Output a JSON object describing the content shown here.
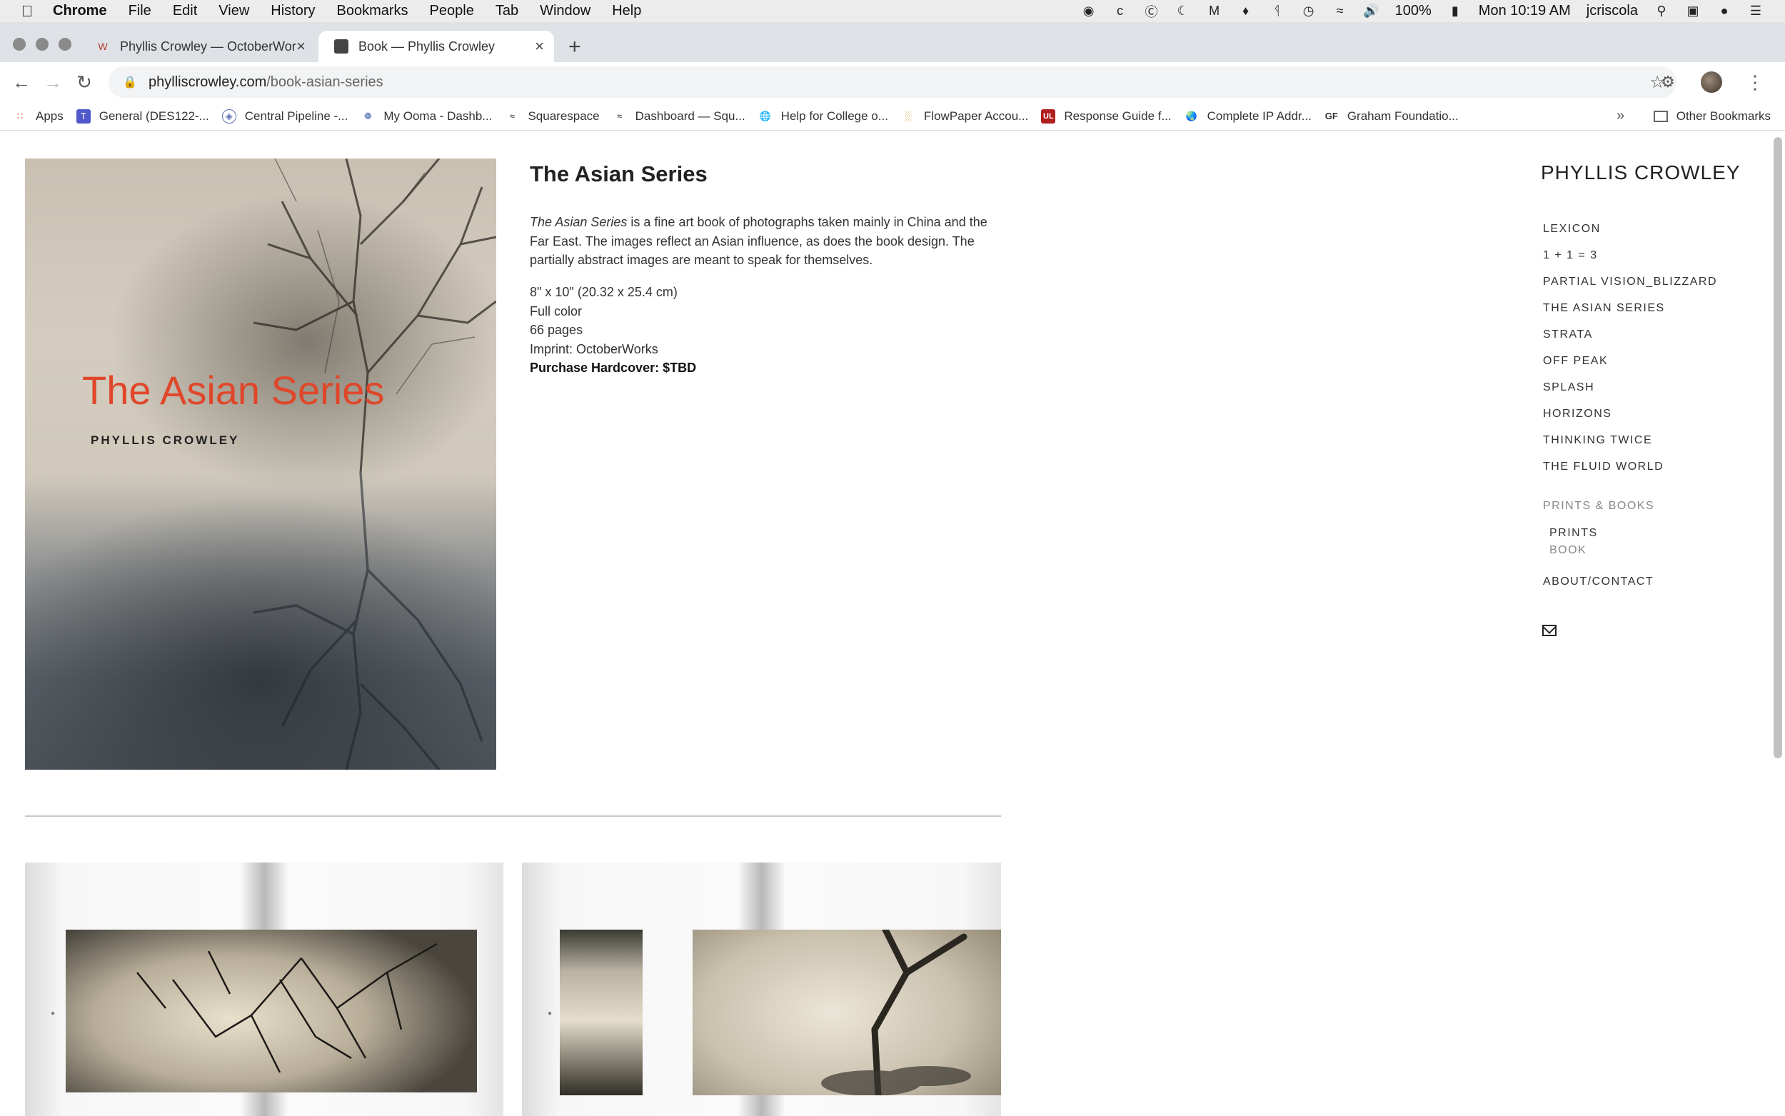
{
  "menubar": {
    "app_name": "Chrome",
    "items": [
      "File",
      "Edit",
      "View",
      "History",
      "Bookmarks",
      "People",
      "Tab",
      "Window",
      "Help"
    ],
    "battery": "100%",
    "clock": "Mon 10:19 AM",
    "user": "jcriscola"
  },
  "tabs": [
    {
      "title": "Phyllis Crowley — OctoberWor",
      "active": false
    },
    {
      "title": "Book — Phyllis Crowley",
      "active": true
    }
  ],
  "address": {
    "host": "phylliscrowley.com",
    "path": "/book-asian-series"
  },
  "bookmarks": {
    "items": [
      "Apps",
      "General (DES122-...",
      "Central Pipeline -...",
      "My Ooma - Dashb...",
      "Squarespace",
      "Dashboard — Squ...",
      "Help for College o...",
      "FlowPaper Accou...",
      "Response Guide f...",
      "Complete IP Addr...",
      "Graham Foundatio..."
    ],
    "more": "»",
    "other": "Other Bookmarks"
  },
  "book": {
    "cover_title": "The Asian Series",
    "cover_author": "PHYLLIS CROWLEY",
    "title": "The Asian Series",
    "description_em": "The Asian Series",
    "description_rest": " is a fine art book of photographs taken mainly in China and the Far East. The images reflect an Asian influence, as does the book design. The partially abstract images are meant to speak for themselves.",
    "size": "8\" x 10\" (20.32 x 25.4 cm)",
    "color": "Full color",
    "pages": "66 pages",
    "imprint": "Imprint: OctoberWorks",
    "purchase": "Purchase Hardcover: $TBD"
  },
  "site": {
    "name": "PHYLLIS CROWLEY",
    "nav": [
      "LEXICON",
      "1 + 1 = 3",
      "PARTIAL VISION_BLIZZARD",
      "THE ASIAN SERIES",
      "STRATA",
      "OFF PEAK",
      "SPLASH",
      "HORIZONS",
      "THINKING TWICE",
      "THE FLUID WORLD"
    ],
    "group_label": "PRINTS & BOOKS",
    "sub_prints": "PRINTS",
    "sub_book": "BOOK",
    "about": "ABOUT/CONTACT"
  }
}
